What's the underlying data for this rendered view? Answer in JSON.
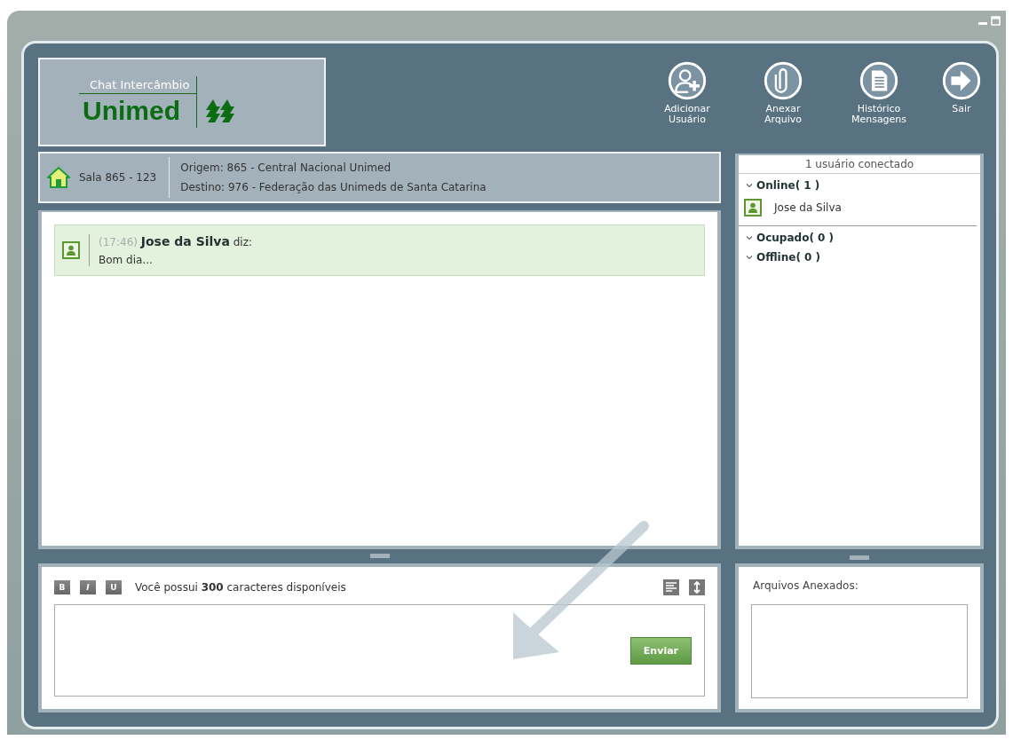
{
  "logo": {
    "subtitle": "Chat Intercâmbio",
    "name": "Unimed"
  },
  "toolbar": [
    {
      "kind": "add-user",
      "label": "Adicionar\nUsuário"
    },
    {
      "kind": "attach",
      "label": "Anexar\nArquivo"
    },
    {
      "kind": "history",
      "label": "Histórico\nMensagens"
    },
    {
      "kind": "exit",
      "label": "Sair"
    }
  ],
  "room": {
    "name": "Sala 865 - 123",
    "origin": "Origem: 865 - Central Nacional Unimed",
    "destination": "Destino: 976 - Federação das Unimeds de Santa Catarina"
  },
  "messages": [
    {
      "time": "(17:46)",
      "author": "Jose da Silva",
      "verb": "diz:",
      "text": "Bom dia..."
    }
  ],
  "users": {
    "header": "1 usuário conectado",
    "groups": [
      {
        "label": "Online( 1 )",
        "expanded": true,
        "members": [
          "Jose da Silva"
        ]
      },
      {
        "label": "Ocupado( 0 )",
        "expanded": true
      },
      {
        "label": "Offline( 0 )",
        "expanded": true
      }
    ]
  },
  "composer": {
    "format_buttons": [
      {
        "kind": "bold",
        "label": "B"
      },
      {
        "kind": "italic",
        "label": "I"
      },
      {
        "kind": "underline",
        "label": "U"
      }
    ],
    "counter": "Você possui **300** caracteres disponíveis",
    "send": "Enviar"
  },
  "attachments": {
    "label": "Arquivos Anexados:"
  }
}
